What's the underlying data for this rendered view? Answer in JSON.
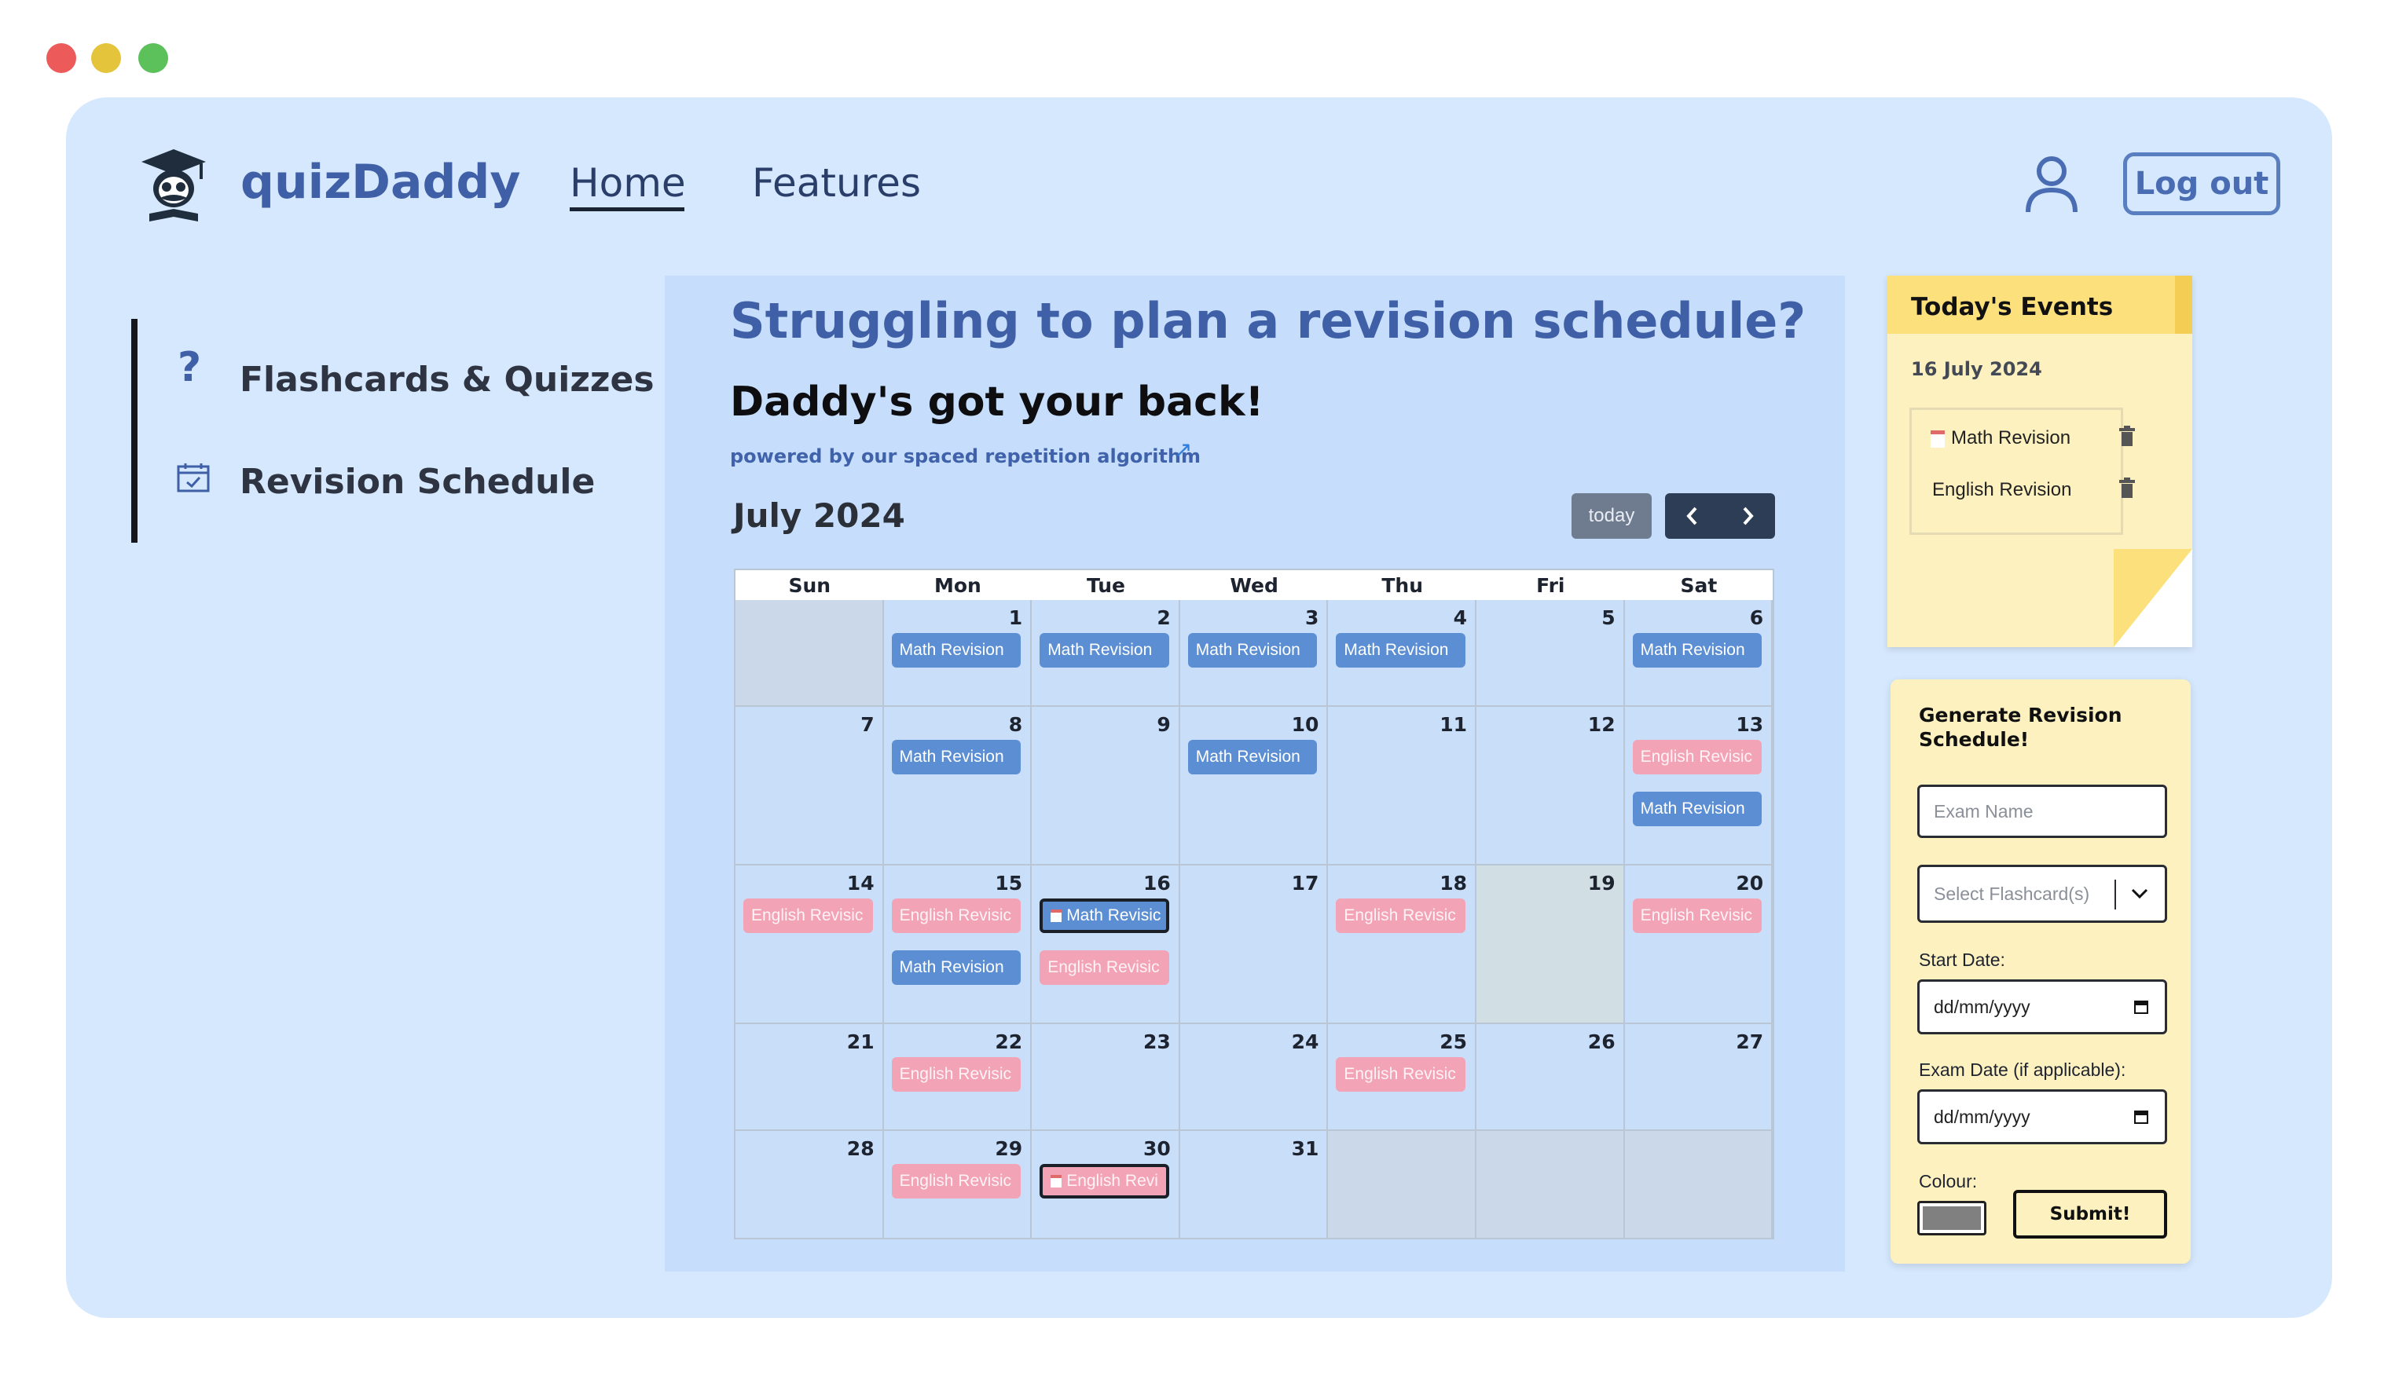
{
  "window": {
    "controls": {
      "close_color": "#ec5a5a",
      "minimize_color": "#e4c43a",
      "maximize_color": "#5cc15a"
    }
  },
  "header": {
    "brand": "quizDaddy",
    "nav": [
      {
        "label": "Home",
        "active": true
      },
      {
        "label": "Features",
        "active": false
      }
    ],
    "logout_label": "Log out"
  },
  "sidebar": {
    "items": [
      {
        "label": "Flashcards & Quizzes",
        "icon": "question-icon"
      },
      {
        "label": "Revision Schedule",
        "icon": "calendar-check-icon"
      }
    ]
  },
  "main": {
    "title": "Struggling to plan a revision schedule?",
    "subtitle": "Daddy's got your back!",
    "powered": "powered by our spaced repetition algorithm",
    "powered_arrow": "↗"
  },
  "calendar": {
    "month_label": "July 2024",
    "today_label": "today",
    "prev_label": "‹",
    "next_label": "›",
    "weekdays": [
      "Sun",
      "Mon",
      "Tue",
      "Wed",
      "Thu",
      "Fri",
      "Sat"
    ],
    "weeks": [
      [
        {
          "day": "",
          "other": true,
          "events": []
        },
        {
          "day": "1",
          "events": [
            {
              "title": "Math Revision",
              "type": "math"
            }
          ]
        },
        {
          "day": "2",
          "events": [
            {
              "title": "Math Revision",
              "type": "math"
            }
          ]
        },
        {
          "day": "3",
          "events": [
            {
              "title": "Math Revision",
              "type": "math"
            }
          ]
        },
        {
          "day": "4",
          "events": [
            {
              "title": "Math Revision",
              "type": "math"
            }
          ]
        },
        {
          "day": "5",
          "events": []
        },
        {
          "day": "6",
          "events": [
            {
              "title": "Math Revision",
              "type": "math"
            }
          ]
        }
      ],
      [
        {
          "day": "7",
          "events": []
        },
        {
          "day": "8",
          "events": [
            {
              "title": "Math Revision",
              "type": "math"
            }
          ]
        },
        {
          "day": "9",
          "events": []
        },
        {
          "day": "10",
          "events": [
            {
              "title": "Math Revision",
              "type": "math"
            }
          ]
        },
        {
          "day": "11",
          "events": []
        },
        {
          "day": "12",
          "events": []
        },
        {
          "day": "13",
          "events": [
            {
              "title": "English Revisic",
              "type": "eng"
            },
            {
              "title": "Math Revision",
              "type": "math"
            }
          ]
        }
      ],
      [
        {
          "day": "14",
          "events": [
            {
              "title": "English Revisic",
              "type": "eng"
            }
          ]
        },
        {
          "day": "15",
          "events": [
            {
              "title": "English Revisic",
              "type": "eng"
            },
            {
              "title": "Math Revision",
              "type": "math"
            }
          ]
        },
        {
          "day": "16",
          "events": [
            {
              "title": "Math Revisic",
              "type": "math",
              "selected": true,
              "icon": true
            },
            {
              "title": "English Revisic",
              "type": "eng"
            }
          ]
        },
        {
          "day": "17",
          "events": []
        },
        {
          "day": "18",
          "events": [
            {
              "title": "English Revisic",
              "type": "eng"
            }
          ]
        },
        {
          "day": "19",
          "highlight": true,
          "events": []
        },
        {
          "day": "20",
          "events": [
            {
              "title": "English Revisic",
              "type": "eng"
            }
          ]
        }
      ],
      [
        {
          "day": "21",
          "events": []
        },
        {
          "day": "22",
          "events": [
            {
              "title": "English Revisic",
              "type": "eng"
            }
          ]
        },
        {
          "day": "23",
          "events": []
        },
        {
          "day": "24",
          "events": []
        },
        {
          "day": "25",
          "events": [
            {
              "title": "English Revisic",
              "type": "eng"
            }
          ]
        },
        {
          "day": "26",
          "events": []
        },
        {
          "day": "27",
          "events": []
        }
      ],
      [
        {
          "day": "28",
          "events": []
        },
        {
          "day": "29",
          "events": [
            {
              "title": "English Revisic",
              "type": "eng"
            }
          ]
        },
        {
          "day": "30",
          "events": [
            {
              "title": "English Revi",
              "type": "eng",
              "selected": true,
              "icon": true
            }
          ]
        },
        {
          "day": "31",
          "events": []
        },
        {
          "day": "",
          "other": true,
          "events": []
        },
        {
          "day": "",
          "other": true,
          "events": []
        },
        {
          "day": "",
          "other": true,
          "events": []
        }
      ]
    ]
  },
  "today_events": {
    "title": "Today's Events",
    "date": "16 July 2024",
    "items": [
      {
        "label": "Math Revision",
        "has_calendar_icon": true
      },
      {
        "label": "English Revision",
        "has_calendar_icon": false
      }
    ]
  },
  "form": {
    "title": "Generate Revision Schedule!",
    "exam_name_placeholder": "Exam Name",
    "flashcards_placeholder": "Select Flashcard(s)",
    "start_date_label": "Start Date:",
    "start_date_value": "dd/mm/yyyy",
    "exam_date_label": "Exam Date (if applicable):",
    "exam_date_value": "dd/mm/yyyy",
    "colour_label": "Colour:",
    "colour_value": "#808080",
    "submit_label": "Submit!"
  }
}
